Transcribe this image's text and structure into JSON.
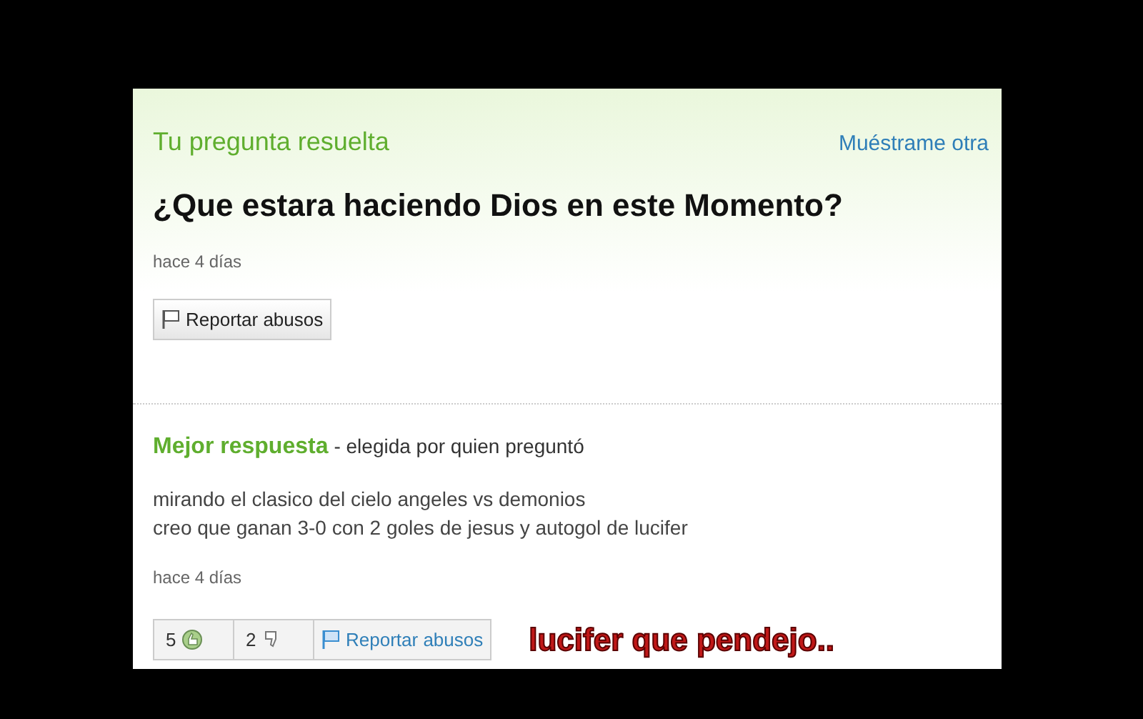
{
  "question": {
    "status": "Tu pregunta resuelta",
    "next_link": "Muéstrame otra",
    "title": "¿Que estara haciendo Dios en este Momento?",
    "time": "hace 4 días",
    "report_button": "Reportar abusos"
  },
  "best_answer": {
    "label": "Mejor respuesta",
    "note": "- elegida por quien preguntó",
    "lines": [
      "mirando el clasico del cielo angeles vs demonios",
      "creo que ganan 3-0 con 2 goles de jesus y autogol de lucifer"
    ],
    "time": "hace 4 días",
    "thumbs_up": "5",
    "thumbs_down": "2",
    "report_button": "Reportar abusos"
  },
  "caption": "lucifer que pendejo.."
}
